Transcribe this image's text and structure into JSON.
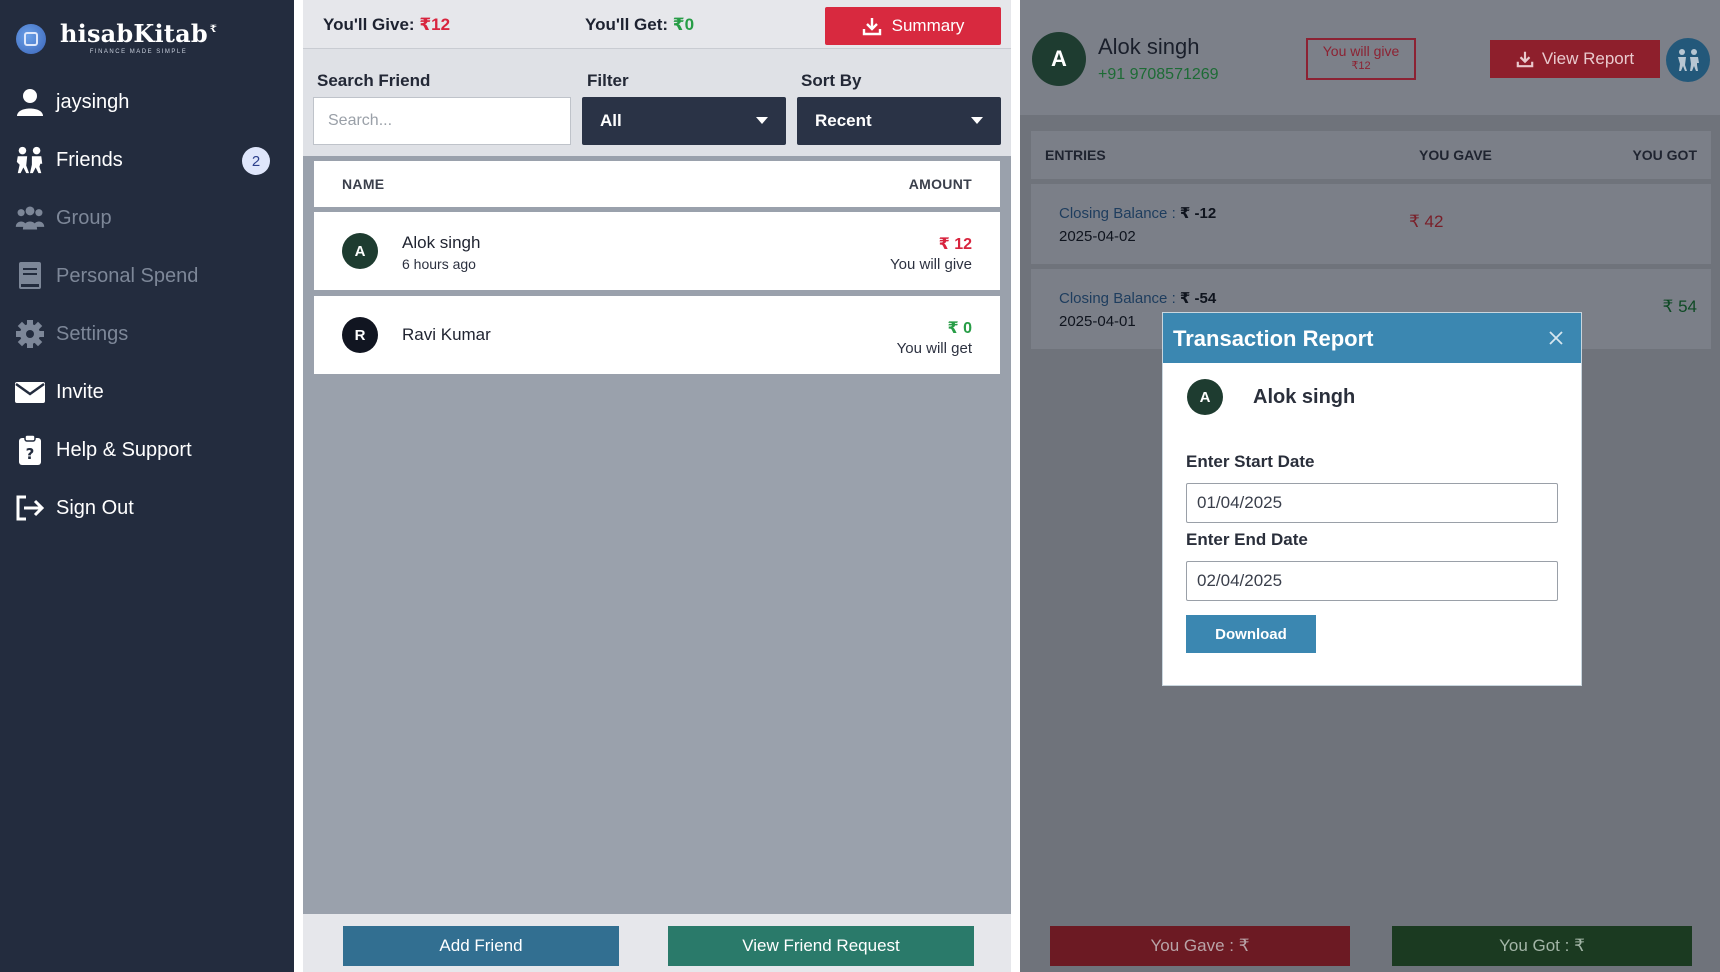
{
  "brand": {
    "name": "hisabKitab",
    "tagline": "FINANCE MADE SIMPLE",
    "sup": "₹"
  },
  "sidebar": {
    "items": [
      {
        "label": "jaysingh",
        "icon": "user-icon",
        "dim": false
      },
      {
        "label": "Friends",
        "icon": "friends-icon",
        "dim": false,
        "badge": "2"
      },
      {
        "label": "Group",
        "icon": "group-icon",
        "dim": true
      },
      {
        "label": "Personal Spend",
        "icon": "book-icon",
        "dim": true
      },
      {
        "label": "Settings",
        "icon": "gear-icon",
        "dim": true
      },
      {
        "label": "Invite",
        "icon": "envelope-icon",
        "dim": false
      },
      {
        "label": "Help & Support",
        "icon": "clipboard-question-icon",
        "dim": false
      },
      {
        "label": "Sign Out",
        "icon": "sign-out-icon",
        "dim": false
      }
    ]
  },
  "middle": {
    "give_label": "You'll Give:",
    "give_value": "₹12",
    "get_label": "You'll Get:",
    "get_value": "₹0",
    "summary_label": "Summary",
    "search_label": "Search Friend",
    "search_placeholder": "Search...",
    "filter_label": "Filter",
    "filter_value": "All",
    "sort_label": "Sort By",
    "sort_value": "Recent",
    "col_name": "NAME",
    "col_amount": "AMOUNT",
    "friends": [
      {
        "initial": "A",
        "name": "Alok singh",
        "time": "6 hours ago",
        "amount": "₹ 12",
        "status": "You will give",
        "tone": "red",
        "avatar_color": "#1e3c30"
      },
      {
        "initial": "R",
        "name": "Ravi Kumar",
        "time": "",
        "amount": "₹ 0",
        "status": "You will get",
        "tone": "green",
        "avatar_color": "#111521"
      }
    ],
    "add_friend_label": "Add Friend",
    "view_requests_label": "View Friend Request"
  },
  "detail": {
    "initial": "A",
    "name": "Alok singh",
    "phone": "+91 9708571269",
    "badge_line1": "You will give",
    "badge_line2": "₹12",
    "report_label": "View Report",
    "col_entries": "ENTRIES",
    "col_gave": "YOU GAVE",
    "col_got": "YOU GOT",
    "entries": [
      {
        "balance_label": "Closing Balance :",
        "balance_value": "₹ -12",
        "date": "2025-04-02",
        "gave": "₹ 42",
        "got": ""
      },
      {
        "balance_label": "Closing Balance :",
        "balance_value": "₹ -54",
        "date": "2025-04-01",
        "gave": "",
        "got": "₹ 54"
      }
    ],
    "you_gave_label": "You Gave : ₹",
    "you_got_label": "You Got : ₹"
  },
  "modal": {
    "title": "Transaction Report",
    "initial": "A",
    "name": "Alok singh",
    "start_label": "Enter Start Date",
    "start_value": "01/04/2025",
    "end_label": "Enter End Date",
    "end_value": "02/04/2025",
    "download_label": "Download"
  }
}
